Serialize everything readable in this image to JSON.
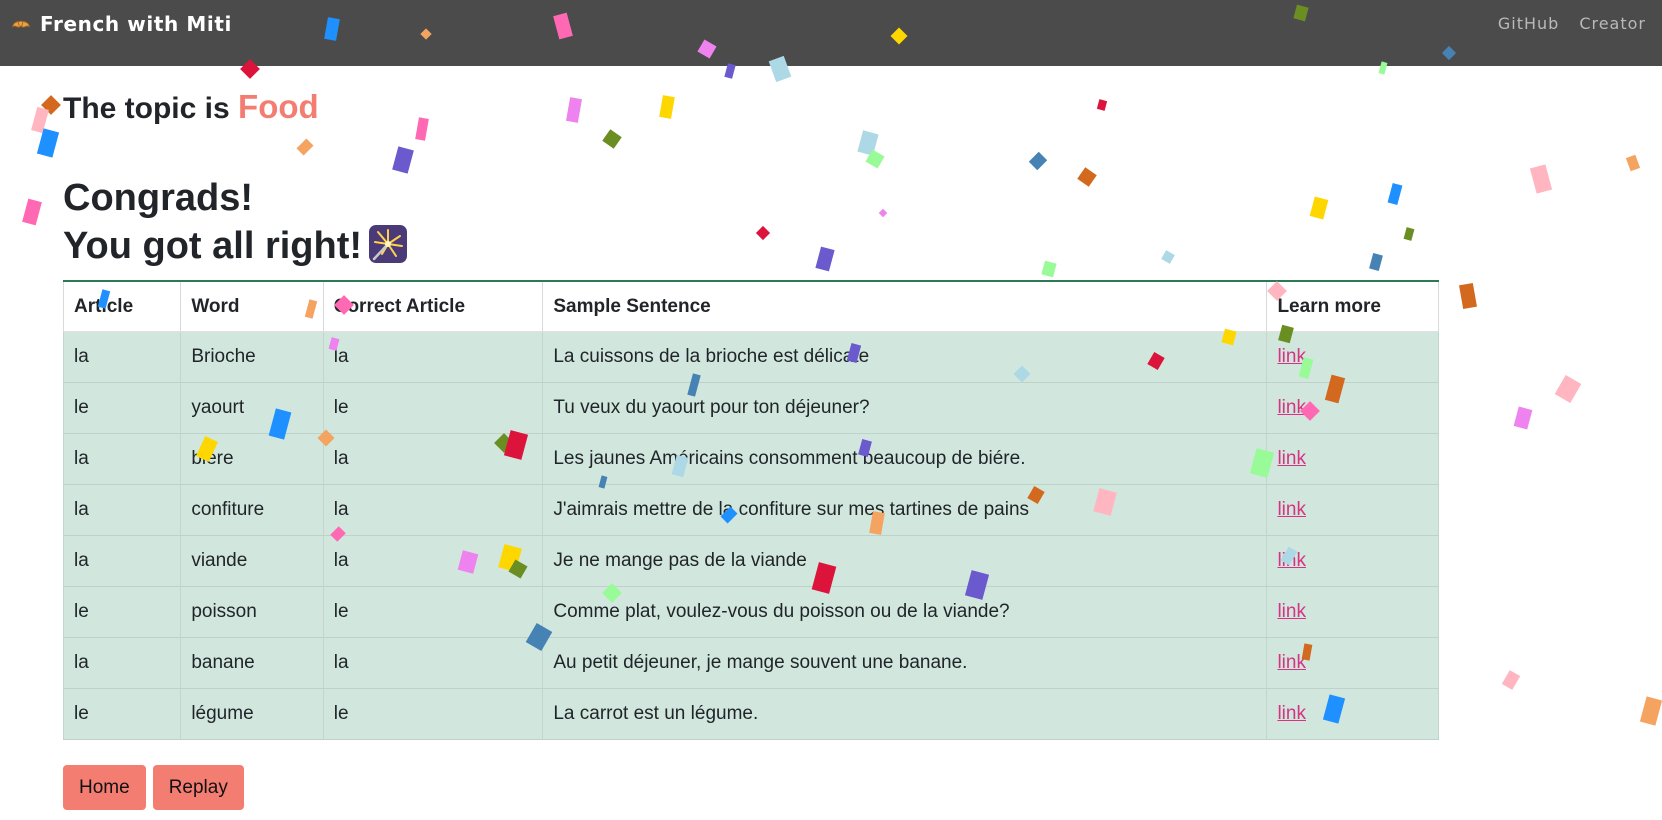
{
  "app": {
    "brand": "French with Miti",
    "brand_icon": "croissant-icon"
  },
  "nav": {
    "links": [
      "GitHub",
      "Creator"
    ]
  },
  "topic": {
    "prefix": "The topic is",
    "name": "Food",
    "accent_color": "#f47d72"
  },
  "result": {
    "line1": "Congrads!",
    "line2": "You got all right!",
    "icon": "sparkler-icon"
  },
  "table": {
    "headers": [
      "Article",
      "Word",
      "Correct Article",
      "Sample Sentence",
      "Learn more"
    ],
    "rows": [
      [
        "la",
        "Brioche",
        "la",
        "La cuissons de la brioche est délicate",
        "link"
      ],
      [
        "le",
        "yaourt",
        "le",
        "Tu veux du yaourt pour ton déjeuner?",
        "link"
      ],
      [
        "la",
        "bière",
        "la",
        "Les jaunes Américains consomment beaucoup de biére.",
        "link"
      ],
      [
        "la",
        "confiture",
        "la",
        "J'aimrais mettre de la confiture sur mes tartines de pains",
        "link"
      ],
      [
        "la",
        "viande",
        "la",
        "Je ne mange pas de la viande",
        "link"
      ],
      [
        "le",
        "poisson",
        "le",
        "Comme plat, voulez-vous du poisson ou de la viande?",
        "link"
      ],
      [
        "la",
        "banane",
        "la",
        "Au petit déjeuner, je mange souvent une banane.",
        "link"
      ],
      [
        "le",
        "légume",
        "le",
        "La carrot est un légume.",
        "link"
      ]
    ],
    "row_color": "#d1e7dd",
    "link_color": "#d63384"
  },
  "buttons": {
    "home": "Home",
    "replay": "Replay",
    "color": "#f47d72"
  },
  "decorations": {
    "confetti_icon": "confetti-overlay",
    "confetti_colors": [
      "#1e90ff",
      "#f4a460",
      "#ff69b4",
      "#ee82ee",
      "#ffd700",
      "#6b8e23",
      "#dc143c",
      "#6a5acd",
      "#add8e6",
      "#98fb98",
      "#4682b4",
      "#d2691e",
      "#ffb6c1"
    ]
  }
}
